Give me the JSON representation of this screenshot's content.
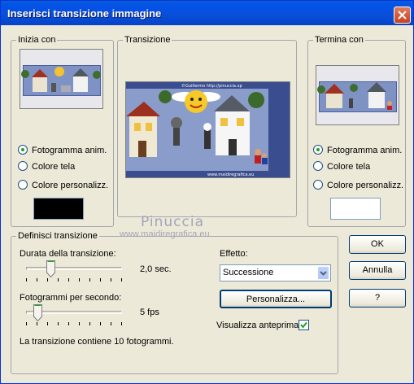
{
  "window": {
    "title": "Inserisci transizione immagine"
  },
  "start_group": {
    "label": "Inizia con",
    "options": [
      "Fotogramma anim.",
      "Colore tela",
      "Colore personalizz."
    ],
    "selected_index": 0,
    "swatch_color": "#000000"
  },
  "transition_group": {
    "label": "Transizione",
    "preview_credit": "©Guillermo  http://pinuccia.xp",
    "preview_footer": "www.maidiregrafica.eu"
  },
  "end_group": {
    "label": "Termina con",
    "options": [
      "Fotogramma anim.",
      "Colore tela",
      "Colore personalizz."
    ],
    "selected_index": 0,
    "swatch_color": "#ffffff"
  },
  "define_group": {
    "label": "Definisci transizione",
    "duration": {
      "label": "Durata della transizione:",
      "value_text": "2,0 sec.",
      "fraction": 0.25
    },
    "fps": {
      "label": "Fotogrammi per secondo:",
      "value_text": "5 fps",
      "fraction": 0.1
    },
    "info": "La transizione contiene 10 fotogrammi.",
    "effect": {
      "label": "Effetto:",
      "selected": "Successione"
    },
    "customize_button": "Personalizza...",
    "preview_checkbox": {
      "label": "Visualizza anteprima",
      "checked": true
    }
  },
  "buttons": {
    "ok": "OK",
    "cancel": "Annulla",
    "help": "?"
  },
  "watermark": {
    "line1": "Pinuccia",
    "line2": "www.maidiregrafica.eu"
  },
  "colors": {
    "title_bar": "#0352e8",
    "dialog_bg": "#ece9d8",
    "accent_green": "#21a121"
  }
}
